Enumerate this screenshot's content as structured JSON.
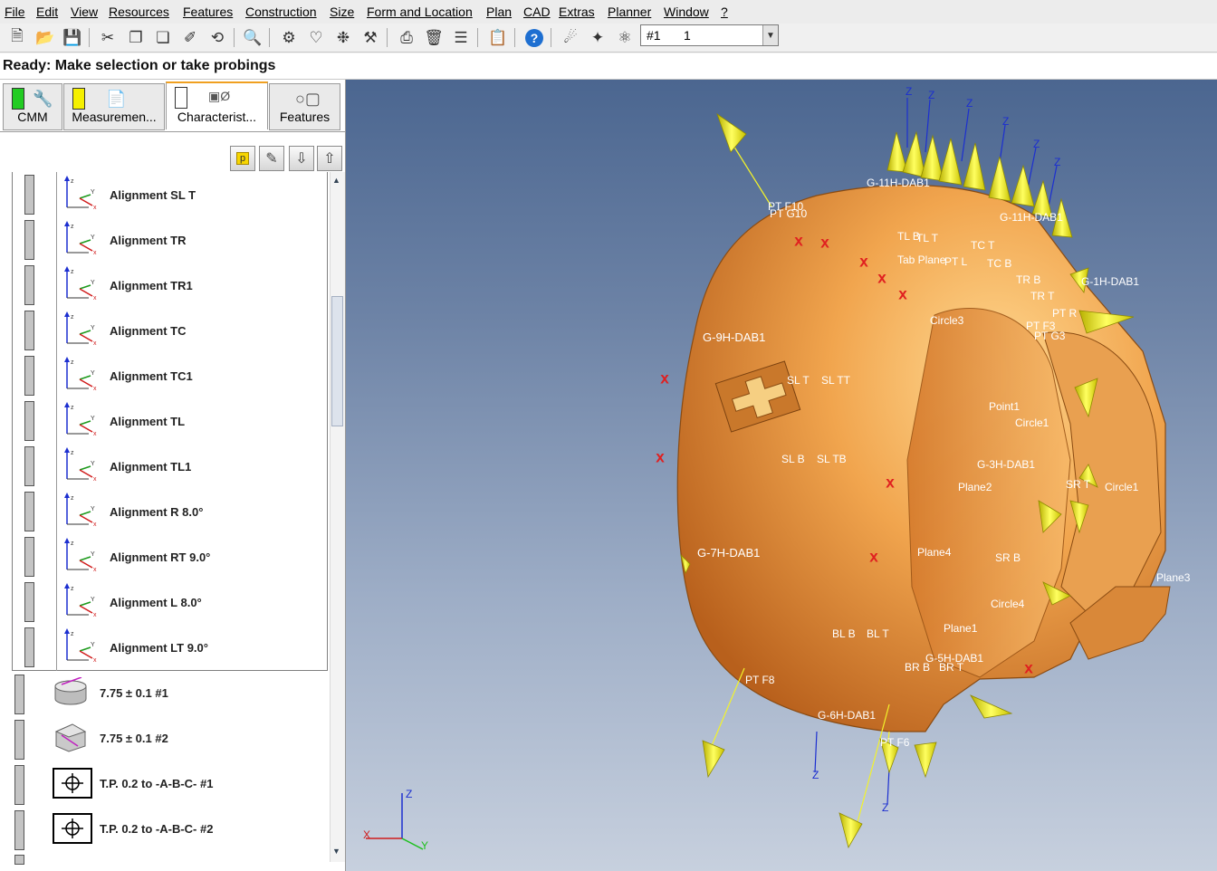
{
  "menu": [
    "File",
    "Edit",
    "View",
    "Resources",
    "Features",
    "Construction",
    "Size",
    "Form and Location",
    "Plan",
    "CAD",
    "Extras",
    "Planner",
    "Window",
    "?"
  ],
  "toolbar": {
    "combo_id": "#1",
    "combo_value": "1"
  },
  "status": "Ready: Make selection or take probings",
  "tabs": [
    {
      "label": "CMM",
      "color": "#22cc22",
      "icon": "wrench-icon"
    },
    {
      "label": "Measuremen...",
      "color": "#f5f000",
      "icon": "report-icon"
    },
    {
      "label": "Characterist...",
      "color": "#ffffff",
      "icon": "characteristic-icon",
      "active": true
    },
    {
      "label": "Features",
      "color": "",
      "icon": "features-icon"
    }
  ],
  "list_tools": [
    "p",
    "edit-icon",
    "move-down-icon",
    "move-up-icon"
  ],
  "alignments": [
    "Alignment SL T",
    "Alignment TR",
    "Alignment TR1",
    "Alignment TC",
    "Alignment TC1",
    "Alignment TL",
    "Alignment TL1",
    "Alignment R 8.0°",
    "Alignment RT 9.0°",
    "Alignment L 8.0°",
    "Alignment LT 9.0°"
  ],
  "characteristics": [
    {
      "label": "7.75 ± 0.1 #1",
      "icon": "cylinder-icon"
    },
    {
      "label": "7.75 ± 0.1 #2",
      "icon": "distance-icon"
    },
    {
      "label": "T.P. 0.2 to -A-B-C- #1",
      "icon": "position-icon"
    },
    {
      "label": "T.P. 0.2 to -A-B-C- #2",
      "icon": "position-icon"
    }
  ],
  "viewport_labels": {
    "g11h": "G-11H-DAB1",
    "g9h": "G-9H-DAB1",
    "g7h": "G-7H-DAB1",
    "g6h": "G-6H-DAB1",
    "g5h": "G-5H-DAB1",
    "g3h": "G-3H-DAB1",
    "g1h": "G-1H-DAB1",
    "g11h2": "G-11H-DAB1",
    "ptf10": "PT F10",
    "ptg10": "PT G10",
    "ptf8": "PT F8",
    "ptf6": "PT F6",
    "ptr": "PT R",
    "ptf3": "PT F3",
    "ptg3": "PT G3",
    "tl": "TL B",
    "tlt": "TL T",
    "tabplane": "Tab Plane",
    "ptl": "PT L",
    "tcb": "TC B",
    "tct": "TC T",
    "trb": "TR B",
    "trt": "TR T",
    "circle3": "Circle3",
    "circle1": "Circle1",
    "circle4": "Circle4",
    "circle1b": "Circle1",
    "slt": "SL T",
    "sltt": "SL TT",
    "slb": "SL B",
    "sltb": "SL TB",
    "point1": "Point1",
    "plane1": "Plane1",
    "plane2": "Plane2",
    "plane3": "Plane3",
    "plane4": "Plane4",
    "blb": "BL B",
    "blt": "BL T",
    "brb": "BR B",
    "brt": "BR T",
    "srb": "SR B",
    "srt": "SR T"
  },
  "colors": {
    "part": "#e8963e",
    "cone": "#f0ef1a",
    "bg_top": "#4b6690",
    "bg_bottom": "#c7d0de"
  }
}
